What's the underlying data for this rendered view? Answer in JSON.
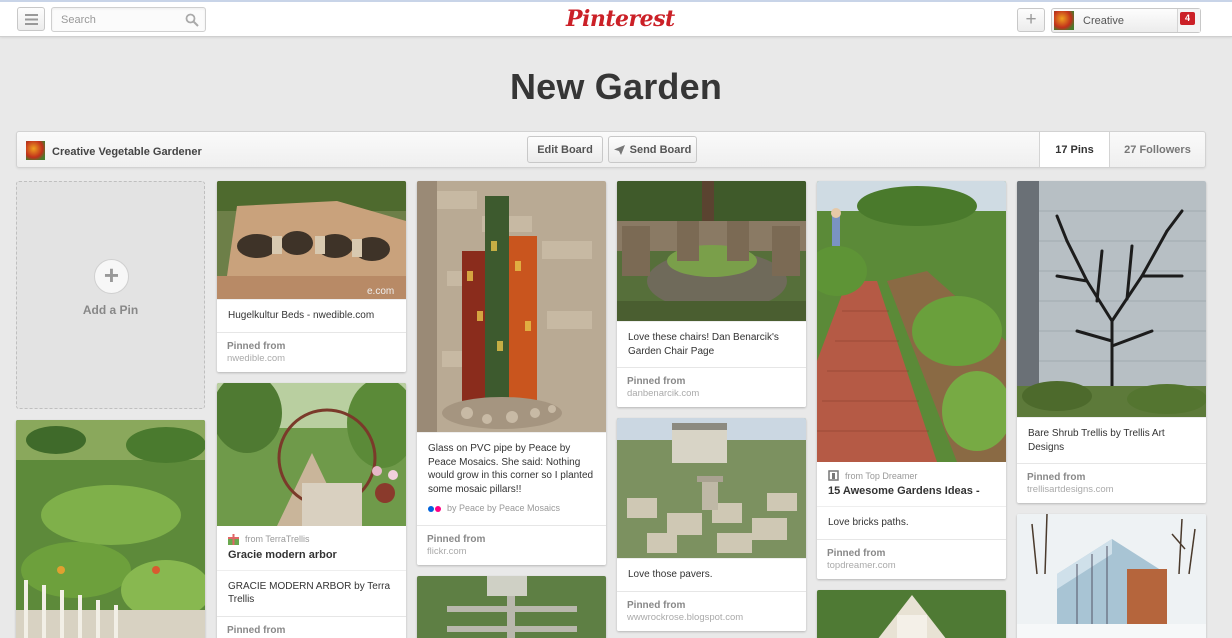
{
  "header": {
    "search_placeholder": "Search",
    "logo": "Pinterest",
    "user_name": "Creative",
    "notification_count": "4"
  },
  "board": {
    "title": "New Garden",
    "owner": "Creative Vegetable Gardener",
    "edit_label": "Edit Board",
    "send_label": "Send Board",
    "pins": "17 Pins",
    "followers": "27 Followers"
  },
  "add_pin_label": "Add a Pin",
  "pins": {
    "hugelkultur": {
      "desc": "Hugelkultur Beds - nwedible.com",
      "pinned_label": "Pinned from",
      "source": "nwedible.com"
    },
    "gracie": {
      "from": "from TerraTrellis",
      "title": "Gracie modern arbor",
      "desc": "GRACIE MODERN ARBOR by Terra Trellis",
      "pinned_label": "Pinned from"
    },
    "glass": {
      "desc": "Glass on PVC pipe by Peace by Peace Mosaics. She said: Nothing would grow in this corner so I planted some mosaic pillars!!",
      "by": "by Peace by Peace Mosaics",
      "pinned_label": "Pinned from",
      "source": "flickr.com"
    },
    "chairs": {
      "desc": "Love these chairs! Dan Benarcik's Garden Chair Page",
      "pinned_label": "Pinned from",
      "source": "danbenarcik.com"
    },
    "pavers": {
      "desc": "Love those pavers.",
      "pinned_label": "Pinned from",
      "source": "wwwrockrose.blogspot.com"
    },
    "bricks": {
      "from": "from Top Dreamer",
      "title": "15 Awesome Gardens Ideas -",
      "desc": "Love bricks paths.",
      "pinned_label": "Pinned from",
      "source": "topdreamer.com"
    },
    "trellis": {
      "desc": "Bare Shrub Trellis by Trellis Art Designs",
      "pinned_label": "Pinned from",
      "source": "trellisartdesigns.com"
    }
  },
  "colors": {
    "brand": "#cb2027",
    "background": "#e9e9e9"
  }
}
